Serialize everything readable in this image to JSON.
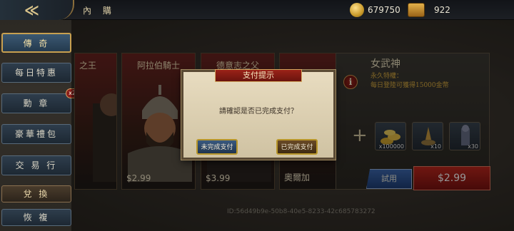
{
  "header": {
    "title": "內 購",
    "gold": "679750",
    "premium": "922"
  },
  "sidebar": {
    "items": [
      {
        "label": "傳 奇"
      },
      {
        "label": "每日特惠"
      },
      {
        "label": "勳 章"
      },
      {
        "label": "豪華禮包"
      },
      {
        "label": "交 易 行"
      },
      {
        "label": "兌 換"
      },
      {
        "label": "恢 複"
      }
    ],
    "badge": "x2"
  },
  "cards": [
    {
      "name": "之王",
      "price": ""
    },
    {
      "name": "阿拉伯騎士",
      "price": "$2.99"
    },
    {
      "name": "德意志之父",
      "price": "$3.99"
    },
    {
      "name": "",
      "bottom": "奧爾加"
    }
  ],
  "featured": {
    "title": "女武神",
    "subtitle": "永久特權：",
    "desc": "每日登陸可獲得15000金幣",
    "items": [
      {
        "icon": "gold-coins-icon",
        "count": "x100000"
      },
      {
        "icon": "tool-icon",
        "count": "x10"
      },
      {
        "icon": "army-icon",
        "count": "x30"
      }
    ],
    "try_label": "試用",
    "price": "$2.99"
  },
  "id_text": "ID:56d49b9e-50b8-40e5-8233-42c685783272",
  "dialog": {
    "title": "支付提示",
    "message": "請確認是否已完成支付？",
    "no_label": "未完成支付",
    "yes_label": "已完成支付"
  }
}
